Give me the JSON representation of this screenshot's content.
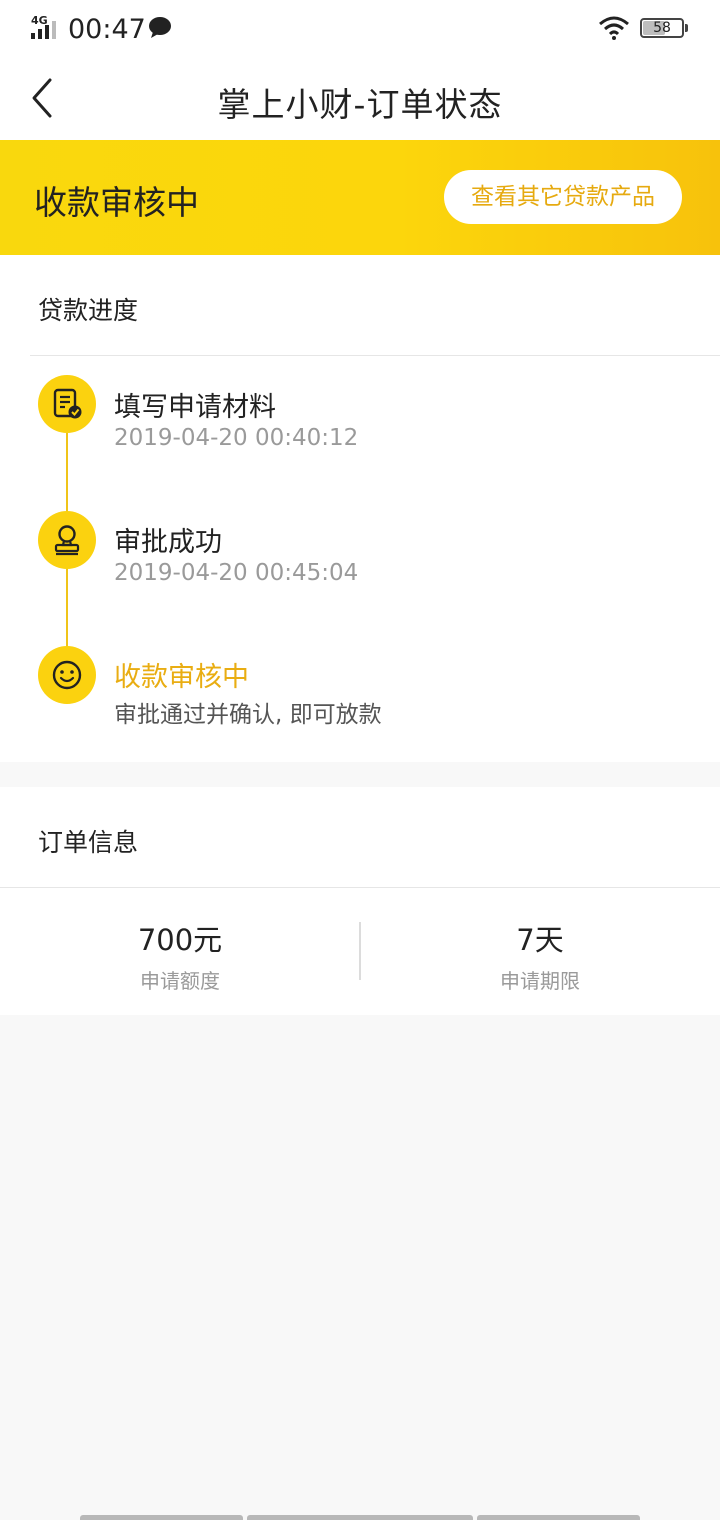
{
  "status_bar": {
    "network": "4G",
    "time": "00:47",
    "battery": "58"
  },
  "nav": {
    "title": "掌上小财-订单状态"
  },
  "banner": {
    "status": "收款审核中",
    "button_label": "查看其它贷款产品"
  },
  "progress": {
    "section_title": "贷款进度",
    "steps": [
      {
        "title": "填写申请材料",
        "subtitle": "2019-04-20 00:40:12",
        "icon": "document-check-icon"
      },
      {
        "title": "审批成功",
        "subtitle": "2019-04-20 00:45:04",
        "icon": "stamp-icon"
      },
      {
        "title": "收款审核中",
        "subtitle": "审批通过并确认, 即可放款",
        "icon": "smiley-icon"
      }
    ]
  },
  "order": {
    "section_title": "订单信息",
    "amount_value": "700元",
    "amount_label": "申请额度",
    "term_value": "7天",
    "term_label": "申请期限"
  },
  "colors": {
    "accent_yellow": "#fbd20f",
    "accent_text": "#e9ad12"
  }
}
